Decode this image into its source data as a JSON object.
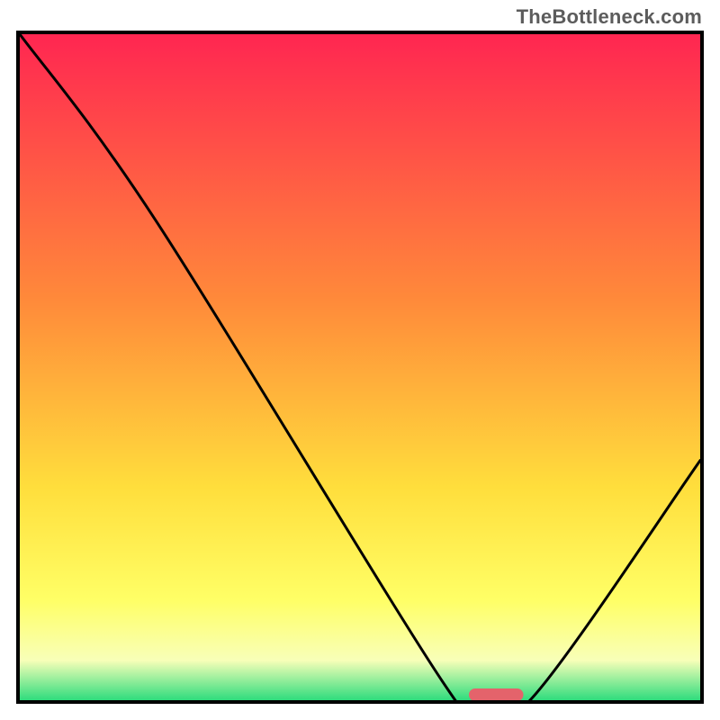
{
  "watermark": "TheBottleneck.com",
  "chart_data": {
    "type": "line",
    "title": "",
    "xlabel": "",
    "ylabel": "",
    "x_range": [
      0,
      100
    ],
    "y_range": [
      0,
      100
    ],
    "curve": [
      {
        "x": 0,
        "y": 100
      },
      {
        "x": 20,
        "y": 72
      },
      {
        "x": 62,
        "y": 3
      },
      {
        "x": 67,
        "y": 0
      },
      {
        "x": 75,
        "y": 0
      },
      {
        "x": 100,
        "y": 36
      }
    ],
    "marker": {
      "x_start": 66,
      "x_end": 74,
      "color": "#e4636b"
    },
    "background_gradient": {
      "top": "#ff2651",
      "mid1": "#ff8a3a",
      "mid2": "#ffde3c",
      "mid3": "#ffff66",
      "mid4": "#f8ffb8",
      "bottom": "#2fdc7d"
    },
    "frame_color": "#000000",
    "curve_color": "#000000"
  }
}
